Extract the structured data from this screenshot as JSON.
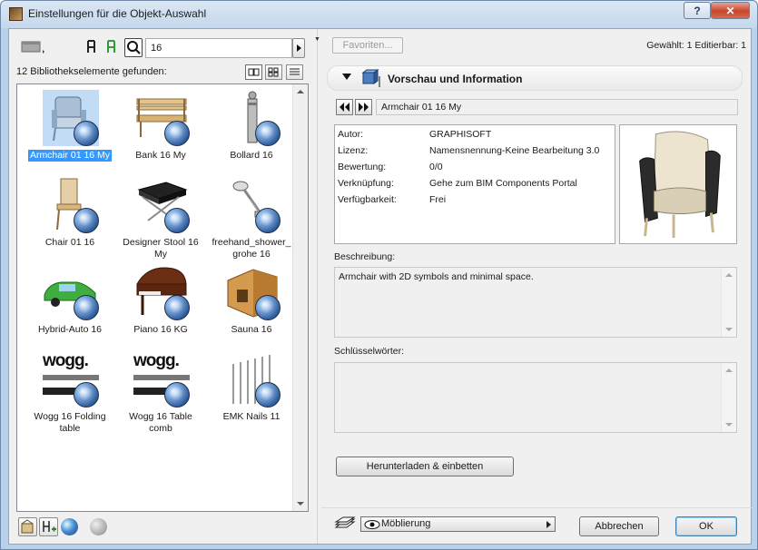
{
  "window": {
    "title": "Einstellungen für die Objekt-Auswahl",
    "help_label": "?",
    "close_label": "✕"
  },
  "search": {
    "value": "16"
  },
  "library": {
    "found_text": "12 Bibliothekselemente gefunden:",
    "items": [
      {
        "label": "Armchair 01 16 My",
        "selected": true
      },
      {
        "label": "Bank 16 My"
      },
      {
        "label": "Bollard 16"
      },
      {
        "label": "Chair 01 16"
      },
      {
        "label": "Designer Stool 16 My"
      },
      {
        "label": "freehand_shower_ grohe 16"
      },
      {
        "label": "Hybrid-Auto 16"
      },
      {
        "label": "Piano 16 KG"
      },
      {
        "label": "Sauna 16"
      },
      {
        "label": "Wogg 16 Folding table"
      },
      {
        "label": "Wogg 16 Table comb"
      },
      {
        "label": "EMK Nails 11"
      }
    ],
    "brand_text": "wogg."
  },
  "right": {
    "favorites_label": "Favoriten...",
    "status": "Gewählt: 1 Editierbar: 1",
    "section_title": "Vorschau und Information",
    "object_name": "Armchair 01 16 My",
    "info": [
      {
        "key": "Autor:",
        "value": "GRAPHISOFT"
      },
      {
        "key": "Lizenz:",
        "value": "Namensnennung-Keine Bearbeitung 3.0"
      },
      {
        "key": "Bewertung:",
        "value": "0/0"
      },
      {
        "key": "Verknüpfung:",
        "value": "Gehe zum BIM Components Portal"
      },
      {
        "key": "Verfügbarkeit:",
        "value": "Frei"
      }
    ],
    "description_label": "Beschreibung:",
    "description": "Armchair with 2D symbols and minimal space.",
    "keywords_label": "Schlüsselwörter:",
    "keywords": "",
    "download_label": "Herunterladen & einbetten"
  },
  "footer": {
    "layer_combo": "Möblierung",
    "cancel_label": "Abbrechen",
    "ok_label": "OK"
  },
  "colors": {
    "selection": "#3399ff",
    "title_bar": "#c4d7ec",
    "close": "#c7452b"
  }
}
